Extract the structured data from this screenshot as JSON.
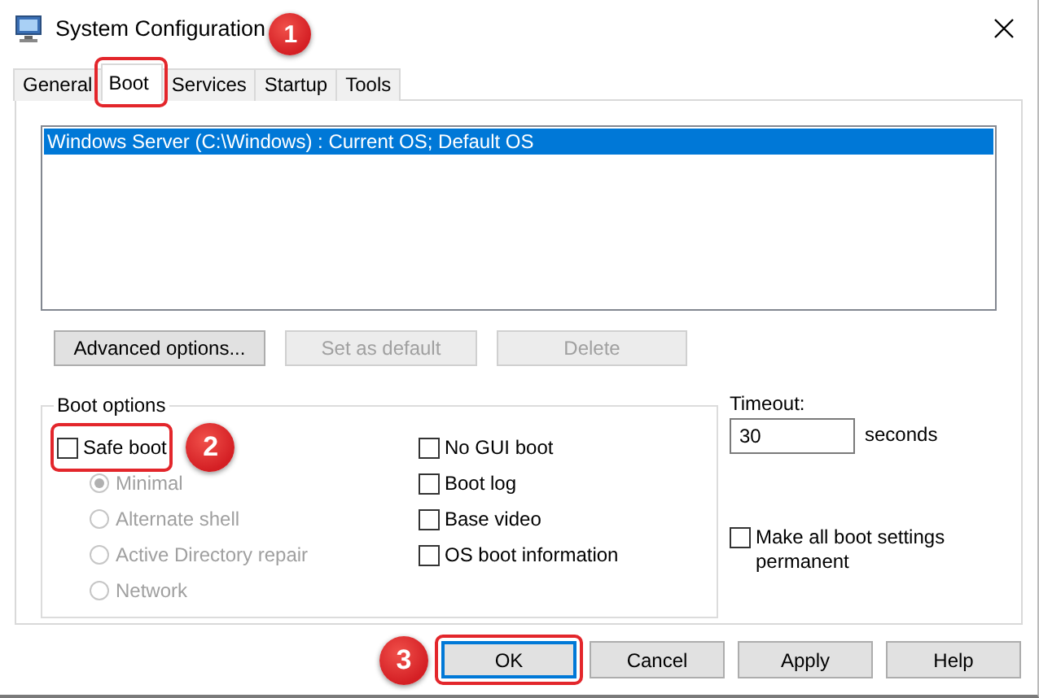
{
  "window": {
    "title": "System Configuration"
  },
  "tabs": [
    {
      "label": "General",
      "selected": false
    },
    {
      "label": "Boot",
      "selected": true,
      "callout": "1"
    },
    {
      "label": "Services",
      "selected": false
    },
    {
      "label": "Startup",
      "selected": false
    },
    {
      "label": "Tools",
      "selected": false
    }
  ],
  "boot_list": {
    "items": [
      {
        "label": "Windows Server (C:\\Windows) : Current OS; Default OS",
        "selected": true
      }
    ]
  },
  "boot_buttons": [
    {
      "label": "Advanced options...",
      "disabled": false
    },
    {
      "label": "Set as default",
      "disabled": true
    },
    {
      "label": "Delete",
      "disabled": true
    }
  ],
  "boot_options": {
    "title": "Boot options",
    "safe_boot": {
      "label": "Safe boot",
      "checked": false,
      "callout": "2"
    },
    "safe_modes": [
      {
        "label": "Minimal",
        "selected": true,
        "disabled": true
      },
      {
        "label": "Alternate shell",
        "selected": false,
        "disabled": true
      },
      {
        "label": "Active Directory repair",
        "selected": false,
        "disabled": true
      },
      {
        "label": "Network",
        "selected": false,
        "disabled": true
      }
    ],
    "flags": [
      {
        "label": "No GUI boot",
        "checked": false
      },
      {
        "label": "Boot log",
        "checked": false
      },
      {
        "label": "Base video",
        "checked": false
      },
      {
        "label": "OS boot information",
        "checked": false
      }
    ]
  },
  "timeout": {
    "label": "Timeout:",
    "value": "30",
    "unit": "seconds"
  },
  "make_permanent": {
    "label": "Make all boot settings permanent",
    "checked": false
  },
  "buttons": [
    {
      "label": "OK",
      "default": true,
      "callout": "3"
    },
    {
      "label": "Cancel",
      "default": false
    },
    {
      "label": "Apply",
      "default": false
    },
    {
      "label": "Help",
      "default": false
    }
  ]
}
